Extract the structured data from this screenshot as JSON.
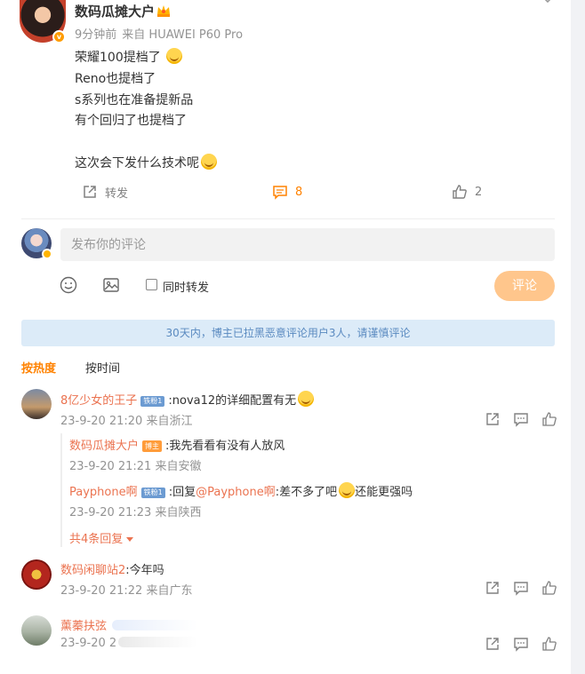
{
  "post": {
    "author": "数码瓜摊大户",
    "time": "9分钟前",
    "source": "来自 HUAWEI P60 Pro",
    "lines": [
      "荣耀100提档了",
      "Reno也提档了",
      "s系列也在准备提新品",
      "有个回归了也提档了",
      "",
      "这次会下发什么技术呢"
    ],
    "repost_label": "转发",
    "comment_count": "8",
    "like_count": "2"
  },
  "composer": {
    "placeholder": "发布你的评论",
    "sync_label": "同时转发",
    "submit_label": "评论"
  },
  "notice": "30天内，博主已拉黑恶意评论用户3人，请谨慎评论",
  "sort": {
    "hot": "按热度",
    "time": "按时间"
  },
  "comments": [
    {
      "name": "8亿少女的王子",
      "level": "铁粉1",
      "text": ":nova12的详细配置有无",
      "date": "23-9-20 21:20",
      "loc": "来自浙江"
    },
    {
      "name": "数码瓜摊大户",
      "badge": "博主",
      "text": ":我先看看有没有人放风",
      "date": "23-9-20 21:21",
      "loc": "来自安徽"
    },
    {
      "name": "Payphone啊",
      "level": "铁粉1",
      "text_prefix": ":回复",
      "mention": "@Payphone啊",
      "text_mid": ":差不多了吧",
      "text_end": "还能更强吗",
      "date": "23-9-20 21:23",
      "loc": "来自陕西"
    },
    {
      "name": "数码闲聊站2",
      "text": ":今年吗",
      "date": "23-9-20 21:22",
      "loc": "来自广东"
    },
    {
      "name": "薰蓁扶弦",
      "date_partial": "23-9-20 2"
    }
  ],
  "more_replies": "共4条回复",
  "icons": {
    "crown": "crown-icon",
    "more": "chevron-down-icon",
    "repost": "repost-icon",
    "comment": "comment-icon",
    "like": "like-icon",
    "emoji": "smiley-icon",
    "image": "image-icon"
  },
  "colors": {
    "accent": "#ff8200",
    "name": "#eb7350",
    "meta": "#939393",
    "notice_bg": "#dcebf8",
    "submit_bg": "#ffc68c"
  }
}
